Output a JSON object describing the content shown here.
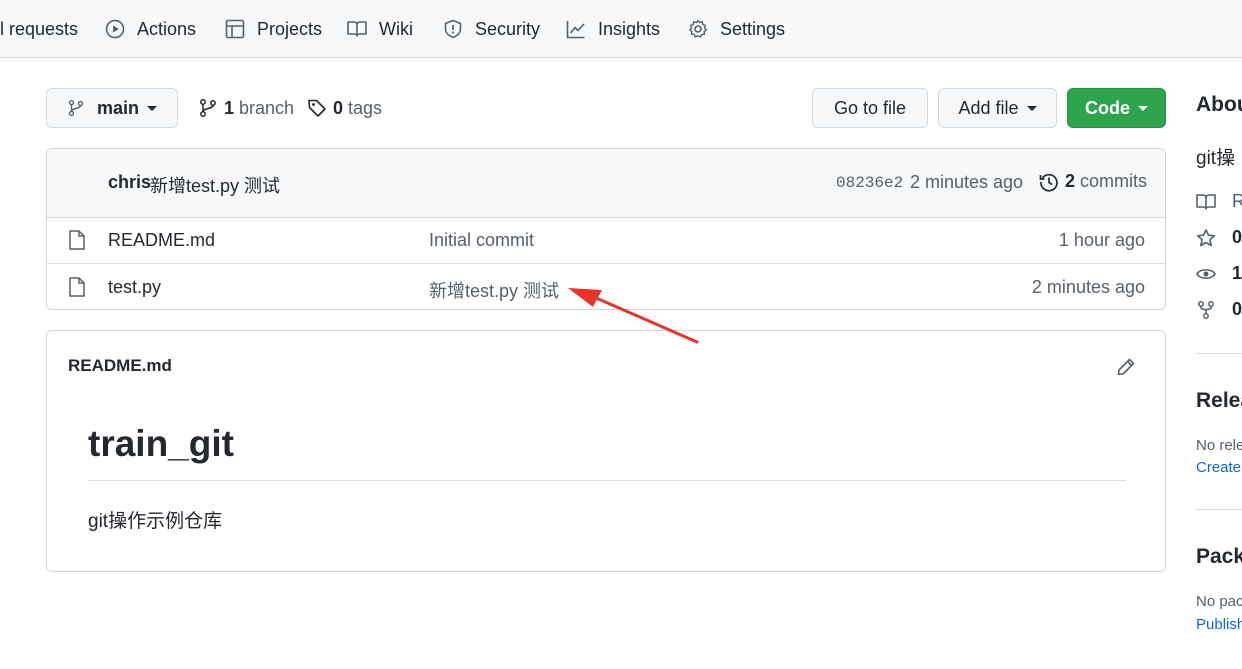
{
  "nav": {
    "tabs": [
      {
        "label": "l requests",
        "icon": "pull-request-icon"
      },
      {
        "label": "Actions",
        "icon": "play-icon"
      },
      {
        "label": "Projects",
        "icon": "table-icon"
      },
      {
        "label": "Wiki",
        "icon": "book-icon"
      },
      {
        "label": "Security",
        "icon": "shield-icon"
      },
      {
        "label": "Insights",
        "icon": "graph-icon"
      },
      {
        "label": "Settings",
        "icon": "gear-icon"
      }
    ]
  },
  "toolbar": {
    "branch_selector": "main",
    "branch_count": "1",
    "branch_label": "branch",
    "tag_count": "0",
    "tag_label": "tags",
    "go_to_file": "Go to file",
    "add_file": "Add file",
    "code": "Code"
  },
  "latest_commit": {
    "author": "chris",
    "message": "新增test.py 测试",
    "sha": "08236e2",
    "time": "2 minutes ago",
    "commit_count": "2",
    "commit_label": "commits"
  },
  "files": [
    {
      "name": "README.md",
      "message": "Initial commit",
      "time": "1 hour ago"
    },
    {
      "name": "test.py",
      "message": "新增test.py 测试",
      "time": "2 minutes ago"
    }
  ],
  "readme": {
    "filename": "README.md",
    "heading": "train_git",
    "body": "git操作示例仓库"
  },
  "sidebar": {
    "about_title": "Abou",
    "description": "git操",
    "stats": [
      {
        "icon": "book-icon",
        "text": "R"
      },
      {
        "icon": "star-icon",
        "text": "0"
      },
      {
        "icon": "eye-icon",
        "text": "1"
      },
      {
        "icon": "fork-icon",
        "text": "0"
      }
    ],
    "releases_title": "Relea",
    "releases_text": "No rele",
    "releases_link": "Create",
    "packages_title": "Packa",
    "packages_text": "No pac",
    "packages_link": "Publish"
  },
  "colors": {
    "accent_green": "#2da44e",
    "link_blue": "#0969da",
    "annotation_arrow": "#e8332a"
  }
}
